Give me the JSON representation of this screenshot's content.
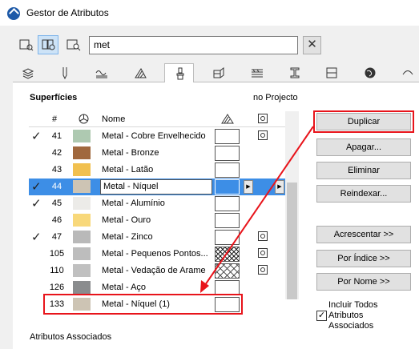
{
  "window": {
    "title": "Gestor de Atributos"
  },
  "search": {
    "value": "met",
    "clear_label": "✕"
  },
  "section": {
    "title": "Superfícies",
    "right_label": "no Projecto",
    "bottom_label": "Atributos Associados"
  },
  "table": {
    "headers": {
      "num": "#",
      "name": "Nome"
    },
    "rows": [
      {
        "check": "✓",
        "num": "41",
        "name": "Metal - Cobre Envelhecido",
        "color": "#aec9b1",
        "fill": "plain",
        "icon": true
      },
      {
        "check": "",
        "num": "42",
        "name": "Metal - Bronze",
        "color": "#a0683e",
        "fill": "plain",
        "icon": false
      },
      {
        "check": "",
        "num": "43",
        "name": "Metal - Latão",
        "color": "#f1c04f",
        "fill": "plain",
        "icon": false
      },
      {
        "check": "✓",
        "num": "44",
        "name": "Metal - Níquel",
        "color": "#cdc4b4",
        "fill": "selected",
        "icon": false,
        "selected": true
      },
      {
        "check": "✓",
        "num": "45",
        "name": "Metal - Alumínio",
        "color": "#ecebe8",
        "fill": "plain",
        "icon": false
      },
      {
        "check": "",
        "num": "46",
        "name": "Metal - Ouro",
        "color": "#f8d87a",
        "fill": "plain",
        "icon": false
      },
      {
        "check": "✓",
        "num": "47",
        "name": "Metal - Zinco",
        "color": "#b9b9b9",
        "fill": "plain",
        "icon": true
      },
      {
        "check": "",
        "num": "105",
        "name": "Metal - Pequenos Pontos...",
        "color": "#bdbdbd",
        "fill": "hatch",
        "icon": true
      },
      {
        "check": "",
        "num": "110",
        "name": "Metal - Vedação de Arame",
        "color": "#c0c0c0",
        "fill": "cross",
        "icon": true
      },
      {
        "check": "",
        "num": "126",
        "name": "Metal - Aço",
        "color": "#8a8c8e",
        "fill": "plain",
        "icon": false
      },
      {
        "check": "",
        "num": "133",
        "name": "Metal - Níquel (1)",
        "color": "#cdc4b4",
        "fill": "plain",
        "icon": false
      }
    ]
  },
  "buttons": {
    "duplicate": "Duplicar",
    "delete": "Apagar...",
    "remove": "Eliminar",
    "reindex": "Reindexar...",
    "add": "Acrescentar >>",
    "by_index": "Por Índice >>",
    "by_name": "Por Nome >>"
  },
  "include_all": {
    "label": "Incluir Todos Atributos Associados",
    "checked": true,
    "mark": "✓"
  },
  "colors": {
    "highlight": "#e8141b",
    "selection": "#3d8ee6",
    "tab_active_bg": "#ffffff"
  }
}
